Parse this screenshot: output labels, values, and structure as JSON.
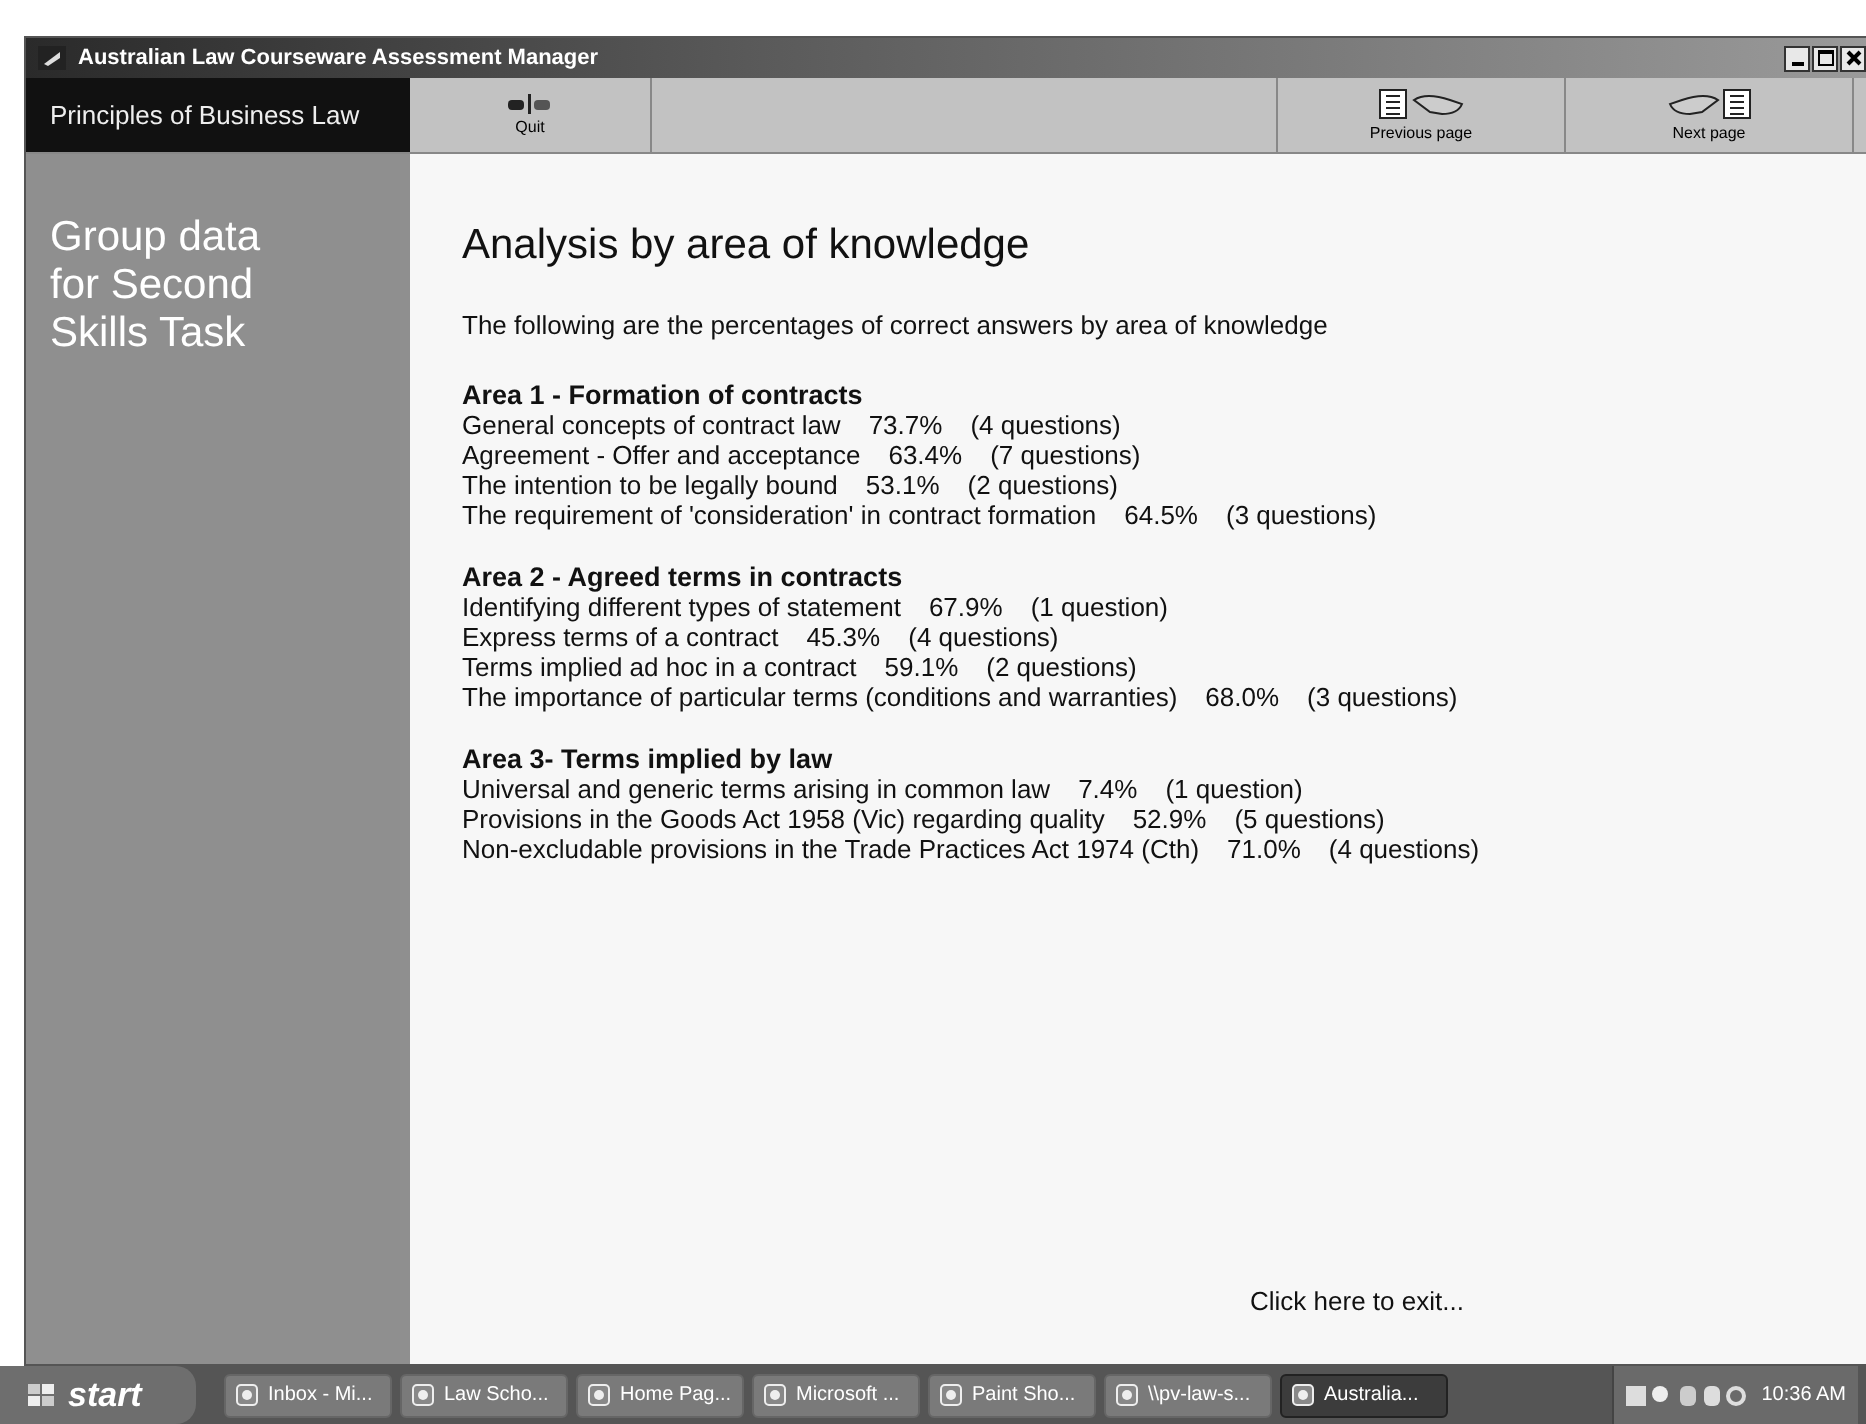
{
  "window": {
    "title": "Australian Law Courseware Assessment Manager"
  },
  "toolbar": {
    "course": "Principles of Business Law",
    "buttons": [
      {
        "label": "Quit",
        "kind": "quit"
      },
      {
        "label": "Previous page",
        "kind": "previous"
      },
      {
        "label": "Next page",
        "kind": "next"
      }
    ]
  },
  "sidebar": {
    "title": "Group data for Second Skills Task"
  },
  "content": {
    "heading": "Analysis by area of knowledge",
    "intro": "The following are the percentages of correct answers by area of knowledge",
    "areas": [
      {
        "title": "Area 1 - Formation of contracts",
        "rows": [
          {
            "topic": "General concepts of contract law",
            "percent": "73.7%",
            "count": "(4 questions)"
          },
          {
            "topic": "Agreement - Offer and acceptance",
            "percent": "63.4%",
            "count": "(7 questions)"
          },
          {
            "topic": "The intention to be legally bound",
            "percent": "53.1%",
            "count": "(2 questions)"
          },
          {
            "topic": "The requirement of 'consideration' in contract formation",
            "percent": "64.5%",
            "count": "(3 questions)"
          }
        ]
      },
      {
        "title": "Area 2 - Agreed terms in contracts",
        "rows": [
          {
            "topic": "Identifying different types of statement",
            "percent": "67.9%",
            "count": "(1 question)"
          },
          {
            "topic": "Express terms of a contract",
            "percent": "45.3%",
            "count": "(4 questions)"
          },
          {
            "topic": "Terms implied ad hoc in a contract",
            "percent": "59.1%",
            "count": "(2 questions)"
          },
          {
            "topic": "The importance of particular terms (conditions and warranties)",
            "percent": "68.0%",
            "count": "(3 questions)"
          }
        ]
      },
      {
        "title": "Area 3- Terms implied by law",
        "rows": [
          {
            "topic": "Universal and generic terms arising in common law",
            "percent": "7.4%",
            "count": "(1 question)"
          },
          {
            "topic": "Provisions in the Goods Act 1958 (Vic) regarding quality",
            "percent": "52.9%",
            "count": "(5 questions)"
          },
          {
            "topic": "Non-excludable provisions in the Trade Practices Act 1974 (Cth)",
            "percent": "71.0%",
            "count": "(4 questions)"
          }
        ]
      }
    ],
    "exit_link": "Click here to exit..."
  },
  "taskbar": {
    "start": "start",
    "tasks": [
      {
        "label": "Inbox - Mi...",
        "selected": false
      },
      {
        "label": "Law Scho...",
        "selected": false
      },
      {
        "label": "Home Pag...",
        "selected": false
      },
      {
        "label": "Microsoft ...",
        "selected": false
      },
      {
        "label": "Paint Sho...",
        "selected": false
      },
      {
        "label": "\\\\pv-law-s...",
        "selected": false
      },
      {
        "label": "Australia...",
        "selected": true
      }
    ],
    "clock": "10:36 AM"
  }
}
